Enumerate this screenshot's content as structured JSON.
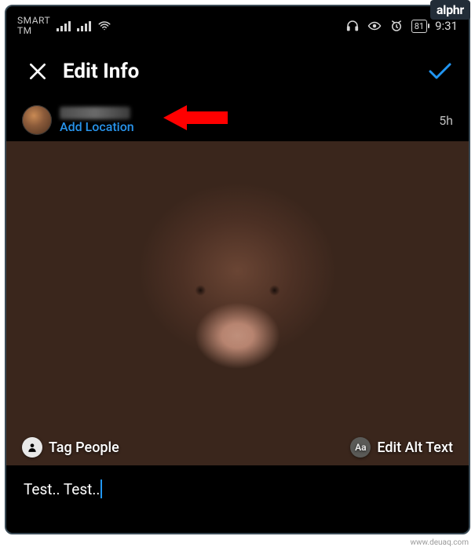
{
  "watermark_brand": "alphr",
  "watermark_url": "www.deuaq.com",
  "status_bar": {
    "carrier_line1": "SMART",
    "carrier_line2": "TM",
    "battery_level": "81",
    "time": "9:31"
  },
  "header": {
    "title": "Edit Info"
  },
  "post": {
    "add_location_label": "Add Location",
    "timestamp": "5h"
  },
  "overlays": {
    "tag_people": "Tag People",
    "edit_alt_text": "Edit Alt Text",
    "alt_icon_text": "Aa"
  },
  "caption": {
    "text": "Test.. Test.."
  }
}
